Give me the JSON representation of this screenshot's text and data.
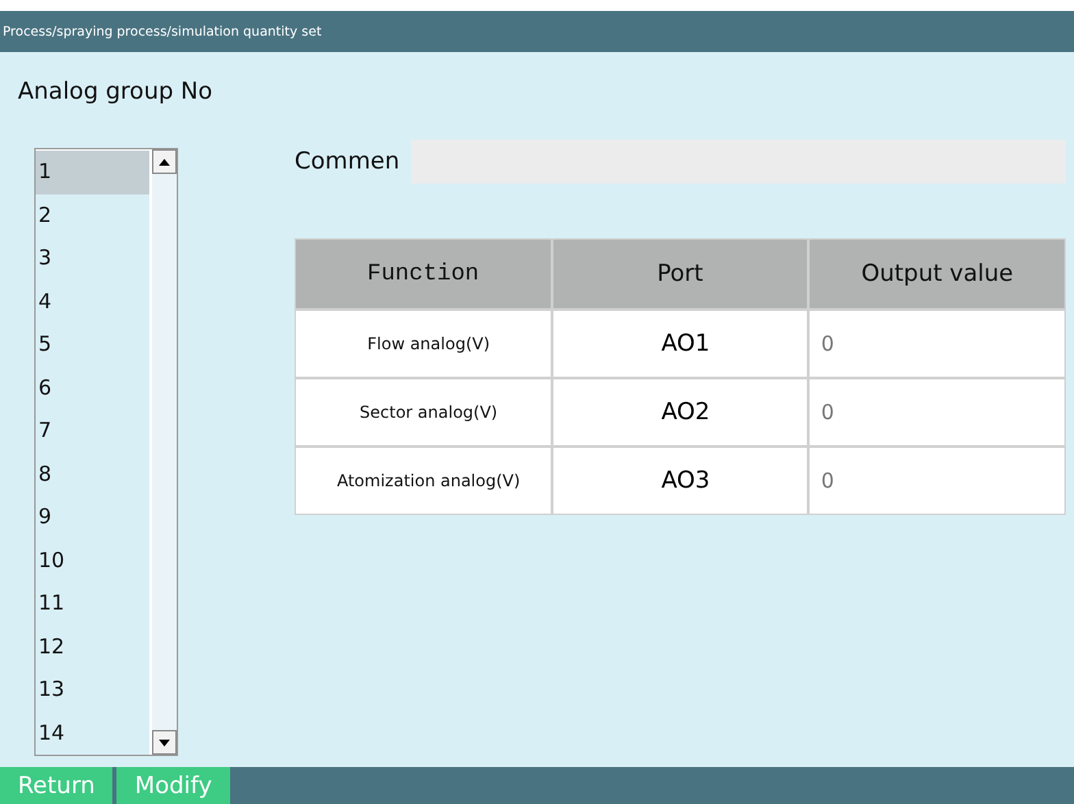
{
  "title": "Process/spraying process/simulation quantity set",
  "group_label": "Analog group No",
  "groups": [
    {
      "label": "1",
      "selected": true
    },
    {
      "label": "2",
      "selected": false
    },
    {
      "label": "3",
      "selected": false
    },
    {
      "label": "4",
      "selected": false
    },
    {
      "label": "5",
      "selected": false
    },
    {
      "label": "6",
      "selected": false
    },
    {
      "label": "7",
      "selected": false
    },
    {
      "label": "8",
      "selected": false
    },
    {
      "label": "9",
      "selected": false
    },
    {
      "label": "10",
      "selected": false
    },
    {
      "label": "11",
      "selected": false
    },
    {
      "label": "12",
      "selected": false
    },
    {
      "label": "13",
      "selected": false
    },
    {
      "label": "14",
      "selected": false
    }
  ],
  "comment_label": "Commen",
  "table": {
    "columns": [
      "Function",
      "Port",
      "Output value"
    ],
    "rows": [
      {
        "function": "Flow analog(V)",
        "port": "AO1",
        "value": "0"
      },
      {
        "function": "Sector analog(V)",
        "port": "AO2",
        "value": "0"
      },
      {
        "function": "Atomization analog(V)",
        "port": "AO3",
        "value": "0"
      }
    ]
  },
  "buttons": [
    "Return",
    "Modify"
  ]
}
